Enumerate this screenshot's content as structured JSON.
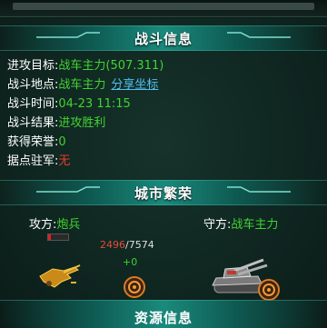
{
  "battle_header": {
    "title": "战斗信息"
  },
  "battle": {
    "target_label": "进攻目标:",
    "target_value": "战车主力(507.311)",
    "location_label": "战斗地点:",
    "location_value": "战车主力",
    "share_link": "分享坐标",
    "time_label": "战斗时间:",
    "time_value": "04-23 11:15",
    "result_label": "战斗结果:",
    "result_value": "进攻胜利",
    "honor_label": "获得荣誉:",
    "honor_value": "0",
    "garrison_label": "据点驻军:",
    "garrison_value": "无"
  },
  "prosperity_header": {
    "title": "城市繁荣"
  },
  "prosperity": {
    "attacker_label": "攻方:",
    "attacker_value": "炮兵",
    "defender_label": "守方:",
    "defender_value": "战车主力",
    "score_current": "2496",
    "score_separator": "/",
    "score_max": "7574",
    "change": "+0",
    "attacker_hp_fraction": 0.15
  },
  "resources_header": {
    "title": "资源信息"
  },
  "colors": {
    "green": "#41d431",
    "red": "#e73a2b",
    "link": "#4fc0f0",
    "header_teal": "#1a8a7c"
  }
}
